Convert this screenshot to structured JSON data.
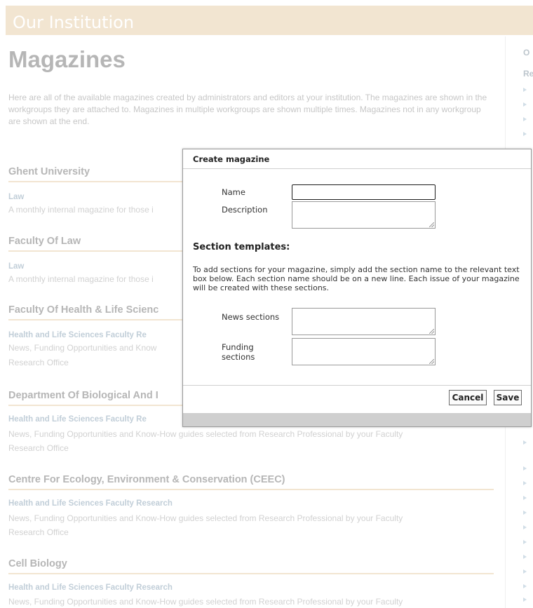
{
  "header": {
    "institution": "Our Institution"
  },
  "page": {
    "title": "Magazines",
    "intro": "Here are all of the available magazines created by administrators and editors at your institution. The magazines are shown in the workgroups they are attached to. Magazines in multiple workgroups are shown multiple times. Magazines not in any workgroup are shown at the end."
  },
  "groups": [
    {
      "name": "Ghent University",
      "magazine": "Law",
      "description": "A monthly internal magazine for those i"
    },
    {
      "name": "Faculty Of Law",
      "magazine": "Law",
      "description": "A monthly internal magazine for those i"
    },
    {
      "name": "Faculty Of Health & Life Scienc",
      "magazine": "Health and Life Sciences Faculty Re",
      "description_line1": "News, Funding Opportunities and Know",
      "description_line2": "Research Office"
    },
    {
      "name": "Department Of Biological And I",
      "magazine": "Health and Life Sciences Faculty Re",
      "description_line1": "News, Funding Opportunities and Know-How guides selected from Research Professional by your Faculty",
      "description_line2": "Research Office"
    },
    {
      "name": "Centre For Ecology, Environment & Conservation (CEEC)",
      "magazine": "Health and Life Sciences Faculty Research",
      "description_line1": "News, Funding Opportunities and Know-How guides selected from Research Professional by your Faculty",
      "description_line2": "Research Office"
    },
    {
      "name": "Cell Biology",
      "magazine": "Health and Life Sciences Faculty Research",
      "description_line1": "News, Funding Opportunities and Know-How guides selected from Research Professional by your Faculty"
    }
  ],
  "sidebar": {
    "heading": "O",
    "subheading": "Re"
  },
  "dialog": {
    "title": "Create magazine",
    "name_label": "Name",
    "name_value": "",
    "description_label": "Description",
    "description_value": "",
    "section_heading": "Section templates:",
    "section_info": "To add sections for your magazine, simply add the section name to the relevant text box below. Each section name should be on a new line. Each issue of your magazine will be created with these sections.",
    "news_label": "News sections",
    "news_value": "",
    "funding_label_line1": "Funding",
    "funding_label_line2": "sections",
    "funding_value": "",
    "cancel_label": "Cancel",
    "save_label": "Save"
  }
}
